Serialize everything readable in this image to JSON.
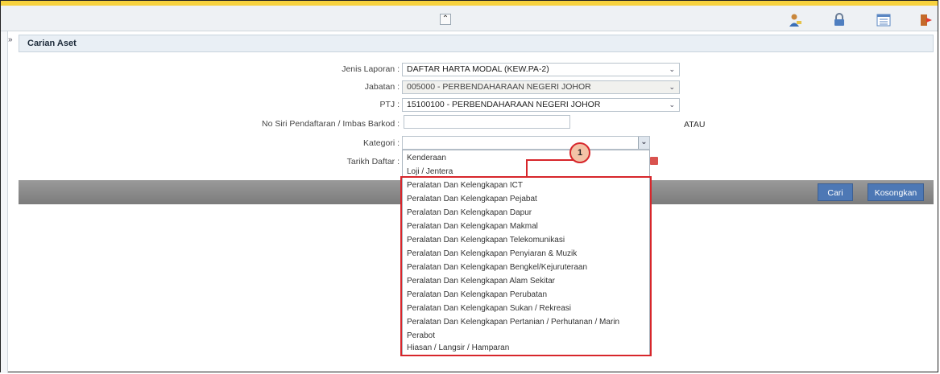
{
  "toolbar": {
    "collapse_glyph": "⌃",
    "icons": [
      "user-icon",
      "lock-icon",
      "list-icon",
      "exit-icon"
    ]
  },
  "section": {
    "title": "Carian Aset",
    "expand_glyph": "»"
  },
  "form": {
    "jenis_laporan": {
      "label": "Jenis Laporan :",
      "value": "DAFTAR HARTA MODAL (KEW.PA-2)"
    },
    "jabatan": {
      "label": "Jabatan :",
      "value": "005000 - PERBENDAHARAAN NEGERI JOHOR"
    },
    "ptj": {
      "label": "PTJ :",
      "value": "15100100 - PERBENDAHARAAN NEGERI JOHOR"
    },
    "no_siri": {
      "label": "No Siri Pendaftaran / Imbas Barkod :",
      "value": ""
    },
    "atau": "ATAU",
    "kategori": {
      "label": "Kategori :",
      "value": ""
    },
    "tarikh_daftar": {
      "label": "Tarikh Daftar :"
    }
  },
  "buttons": {
    "cari": "Cari",
    "kosongkan": "Kosongkan"
  },
  "dropdown": {
    "items": [
      "Kenderaan",
      "Loji / Jentera",
      "Peralatan Dan Kelengkapan ICT",
      "Peralatan Dan Kelengkapan Pejabat",
      "Peralatan Dan Kelengkapan Dapur",
      "Peralatan Dan Kelengkapan Makmal",
      "Peralatan Dan Kelengkapan Telekomunikasi",
      "Peralatan Dan Kelengkapan Penyiaran & Muzik",
      "Peralatan Dan Kelengkapan Bengkel/Kejuruteraan",
      "Peralatan Dan Kelengkapan Alam Sekitar",
      "Peralatan Dan Kelengkapan Perubatan",
      "Peralatan Dan Kelengkapan Sukan / Rekreasi",
      "Peralatan Dan Kelengkapan Pertanian / Perhutanan / Marin",
      "Perabot",
      "Hiasan / Langsir / Hamparan"
    ]
  },
  "annotation": {
    "callout_number": "1",
    "color": "#d7262b"
  },
  "colors": {
    "button_blue": "#4d78b5",
    "header_yellow": "#f7d23e"
  }
}
